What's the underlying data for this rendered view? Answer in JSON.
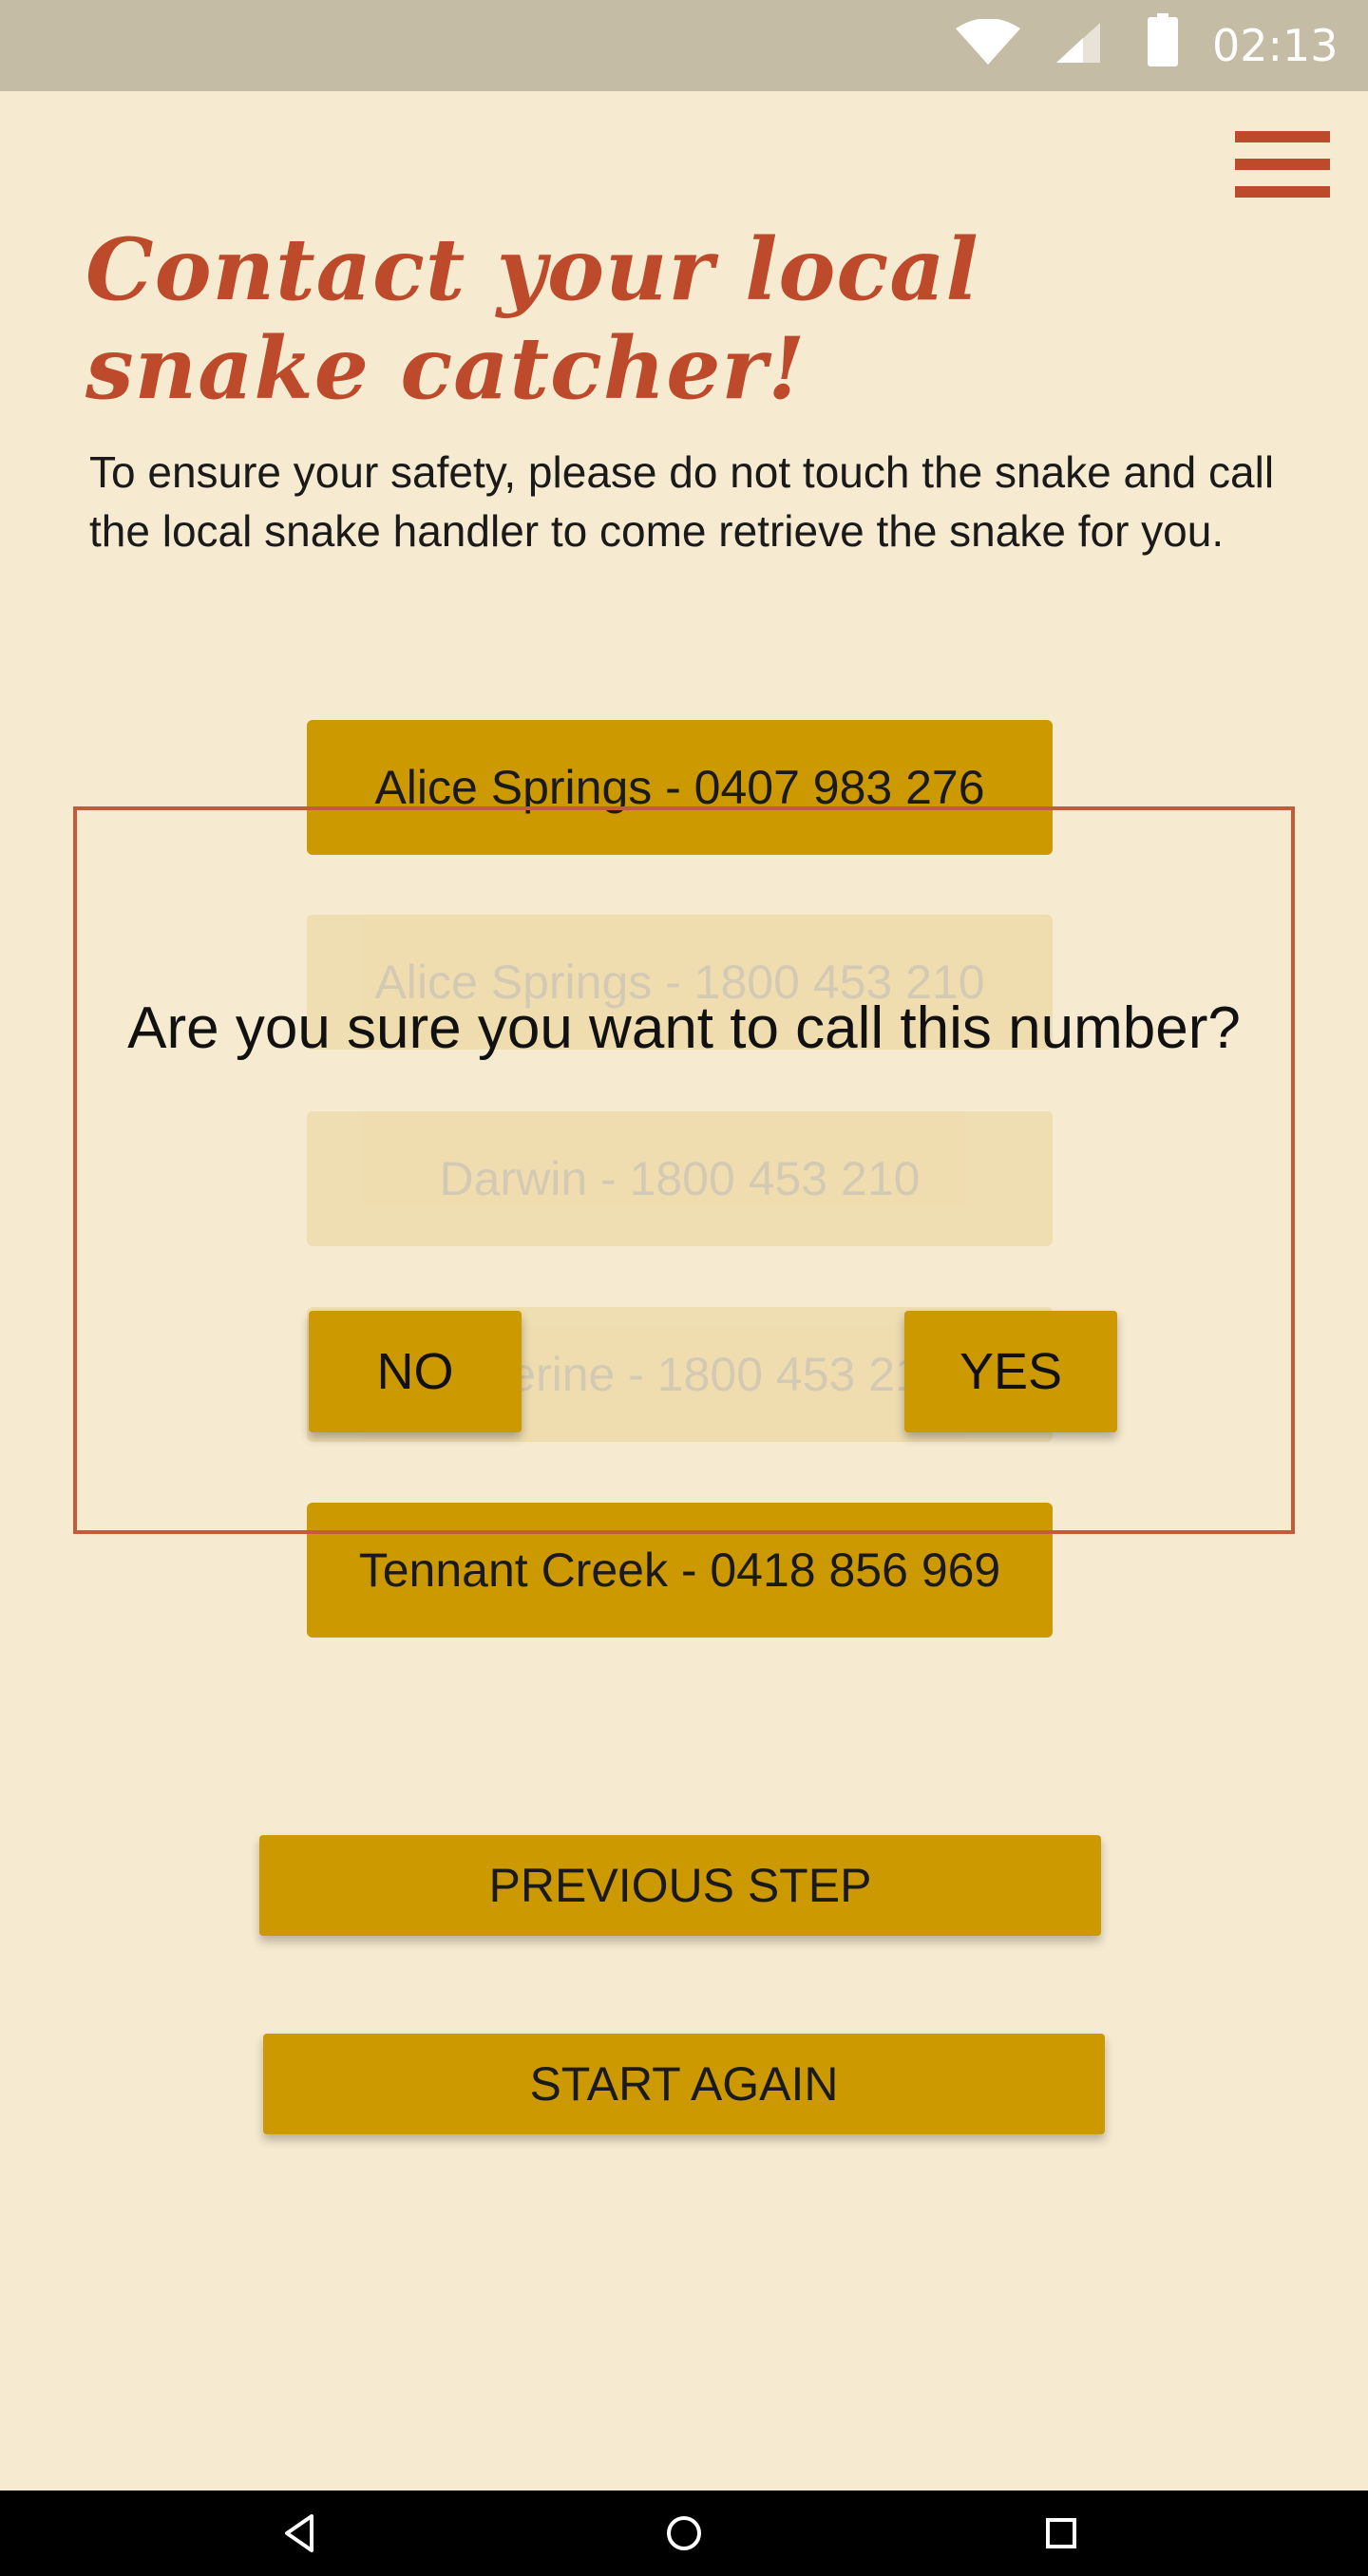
{
  "status_bar": {
    "time": "02:13",
    "icons": [
      "wifi-icon",
      "cell-signal-icon",
      "battery-icon"
    ]
  },
  "header": {
    "menu_icon": "hamburger-menu-icon",
    "title": "Contact your local snake catcher!",
    "intro": "To ensure your safety, please do not touch the snake and call the local snake handler to come retrieve the snake for you."
  },
  "contacts": [
    {
      "label": "Alice Springs - 0407 983 276"
    },
    {
      "label": "Alice Springs - 1800 453 210"
    },
    {
      "label": "Darwin - 1800 453 210"
    },
    {
      "label": "Katherine - 1800 453 210"
    },
    {
      "label": "Tennant Creek - 0418 856 969"
    }
  ],
  "actions": {
    "previous_step": "PREVIOUS STEP",
    "start_again": "START AGAIN"
  },
  "dialog": {
    "question": "Are you sure you want to call this number?",
    "no_label": "NO",
    "yes_label": "YES"
  },
  "nav_bar": {
    "icons": [
      "back-icon",
      "home-icon",
      "recent-apps-icon"
    ]
  },
  "colors": {
    "background": "#f6ead0",
    "accent": "#bd4a2b",
    "button": "#cc9900",
    "status_bar": "#c5bca5"
  }
}
